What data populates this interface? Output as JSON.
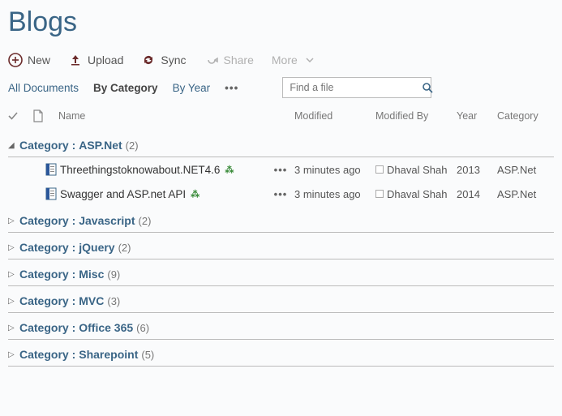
{
  "page": {
    "title": "Blogs"
  },
  "toolbar": {
    "new": "New",
    "upload": "Upload",
    "sync": "Sync",
    "share": "Share",
    "more": "More"
  },
  "views": {
    "all": "All Documents",
    "byCategory": "By Category",
    "byYear": "By Year",
    "ellipsis": "•••"
  },
  "search": {
    "placeholder": "Find a file"
  },
  "columns": {
    "name": "Name",
    "modified": "Modified",
    "modifiedBy": "Modified By",
    "year": "Year",
    "category": "Category"
  },
  "groupLabel": "Category",
  "groups": [
    {
      "value": "ASP.Net",
      "count": 2,
      "expanded": true,
      "items": [
        {
          "name": "Threethingstoknowabout.NET4.6",
          "isNew": true,
          "modified": "3 minutes ago",
          "modifiedBy": "Dhaval Shah",
          "year": "2013",
          "category": "ASP.Net"
        },
        {
          "name": "Swagger and ASP.net API",
          "isNew": true,
          "modified": "3 minutes ago",
          "modifiedBy": "Dhaval Shah",
          "year": "2014",
          "category": "ASP.Net"
        }
      ]
    },
    {
      "value": "Javascript",
      "count": 2,
      "expanded": false,
      "items": []
    },
    {
      "value": "jQuery",
      "count": 2,
      "expanded": false,
      "items": []
    },
    {
      "value": "Misc",
      "count": 9,
      "expanded": false,
      "items": []
    },
    {
      "value": "MVC",
      "count": 3,
      "expanded": false,
      "items": []
    },
    {
      "value": "Office 365",
      "count": 6,
      "expanded": false,
      "items": []
    },
    {
      "value": "Sharepoint",
      "count": 5,
      "expanded": false,
      "items": []
    }
  ]
}
